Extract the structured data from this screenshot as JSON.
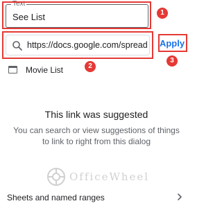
{
  "text_field": {
    "label": "Text",
    "value": "See List"
  },
  "link_field": {
    "value": "https://docs.google.com/spreadsheets",
    "icon": "search-icon"
  },
  "apply_label": "Apply",
  "badges": [
    "1",
    "2",
    "3"
  ],
  "list_item": {
    "label": "Movie List",
    "icon": "sheet-icon"
  },
  "empty_state": {
    "title": "This link was suggested",
    "body": "You can search or view suggestions of things to link to right from this dialog"
  },
  "watermark": {
    "text": "OfficeWheel"
  },
  "bottom": {
    "label": "Sheets and named ranges",
    "icon": "chevron-right-icon"
  },
  "colors": {
    "accent": "#1a73e8",
    "highlight": "#e53935"
  }
}
